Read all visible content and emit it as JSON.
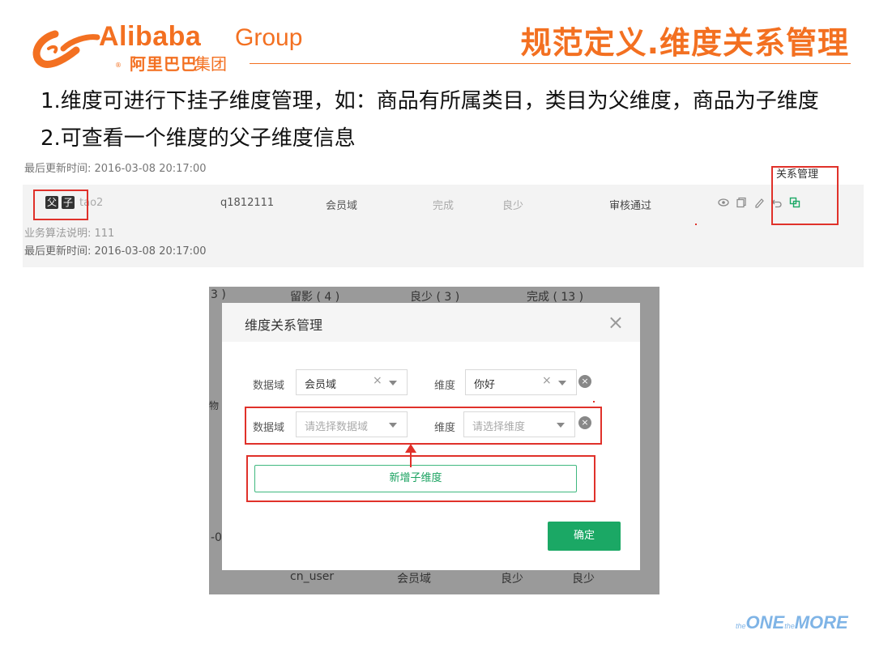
{
  "header": {
    "brand_en": "Alibaba",
    "brand_group": "Group",
    "brand_cn": "阿里巴巴",
    "brand_cn2": "集团",
    "reg": "®",
    "slide_title": "规范定义.维度关系管理"
  },
  "bullets": [
    "1.维度可进行下挂子维度管理，如：商品有所属类目，类目为父维度，商品为子维度",
    "2.可查看一个维度的父子维度信息"
  ],
  "list_strip": {
    "prev_timestamp": "最后更新时间: 2016-03-08 20:17:00",
    "parent_tag": "父",
    "child_tag": "子",
    "row": {
      "name": "tao2",
      "code": "q1812111",
      "domain": "会员域",
      "status1": "完成",
      "status2": "良少",
      "review": "审核通过"
    },
    "desc": "业务算法说明: 111",
    "timestamp": "最后更新时间: 2016-03-08 20:17:00",
    "tooltip": "关系管理",
    "action_icons": [
      "eye-icon",
      "copy-icon",
      "edit-icon",
      "undo-icon",
      "relation-icon"
    ]
  },
  "modal_bg": {
    "top_left": "3 )",
    "top1": "留影 ( 4 )",
    "top2": "良少 ( 3 )",
    "top3": "完成 ( 13 )",
    "side1": "物",
    "side2": "-0",
    "bottom1": "cn_user",
    "bottom2": "会员域",
    "bottom3": "良少",
    "bottom4": "良少"
  },
  "modal": {
    "title": "维度关系管理",
    "close_glyph": "×",
    "rows": [
      {
        "domain_label": "数据域",
        "domain_value": "会员域",
        "dim_label": "维度",
        "dim_value": "你好"
      },
      {
        "domain_label": "数据域",
        "domain_placeholder": "请选择数据域",
        "dim_label": "维度",
        "dim_placeholder": "请选择维度"
      }
    ],
    "clear_glyph": "×",
    "remove_glyph": "×",
    "add_button": "新增子维度",
    "ok_button": "确定"
  },
  "footer": {
    "the1": "the",
    "one": "ONE",
    "the2": "the",
    "more": "MORE"
  },
  "colors": {
    "brand_orange": "#f37021",
    "highlight_red": "#e0312a",
    "primary_green": "#1ba865"
  }
}
